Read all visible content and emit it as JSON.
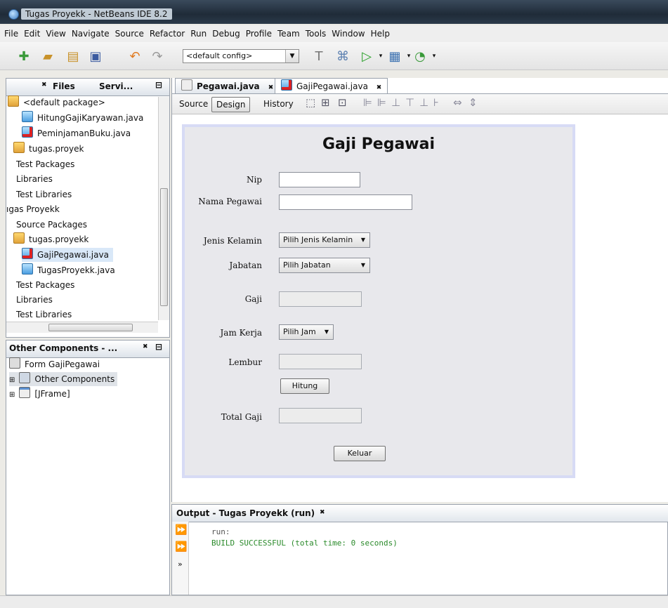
{
  "window": {
    "title": "Tugas Proyekk - NetBeans IDE 8.2"
  },
  "menu": [
    "File",
    "Edit",
    "View",
    "Navigate",
    "Source",
    "Refactor",
    "Run",
    "Debug",
    "Profile",
    "Team",
    "Tools",
    "Window",
    "Help"
  ],
  "toolbar": {
    "config": "<default config>"
  },
  "files_panel": {
    "tab_files": "Files",
    "tab_services": "Servi...",
    "rows": [
      "<default package>",
      "HitungGajiKaryawan.java",
      "PeminjamanBuku.java",
      "tugas.proyek",
      "Test Packages",
      "Libraries",
      "Test Libraries",
      "ıgas Proyekk",
      "Source Packages",
      "tugas.proyekk",
      "GajiPegawai.java",
      "TugasProyekk.java",
      "Test Packages",
      "Libraries",
      "Test Libraries"
    ]
  },
  "navigator": {
    "title": "Other Components - ...",
    "rows": [
      "Form GajiPegawai",
      "Other Components",
      "[JFrame]"
    ]
  },
  "editor": {
    "tabs": [
      "Pegawai.java",
      "GajiPegawai.java"
    ],
    "modes": [
      "Source",
      "Design",
      "History"
    ]
  },
  "form": {
    "title": "Gaji Pegawai",
    "labels": {
      "nip": "Nip",
      "nama": "Nama Pegawai",
      "jenis_kelamin": "Jenis Kelamin",
      "jabatan": "Jabatan",
      "gaji": "Gaji",
      "jam_kerja": "Jam Kerja",
      "lembur": "Lembur",
      "total_gaji": "Total Gaji"
    },
    "combo": {
      "jenis_kelamin": "Pilih Jenis Kelamin",
      "jabatan": "Pilih Jabatan",
      "jam_kerja": "Pilih Jam"
    },
    "buttons": {
      "hitung": "Hitung",
      "keluar": "Keluar"
    }
  },
  "output": {
    "title": "Output - Tugas Proyekk (run)",
    "lines": [
      "run:",
      "BUILD SUCCESSFUL (total time: 0 seconds)"
    ]
  }
}
